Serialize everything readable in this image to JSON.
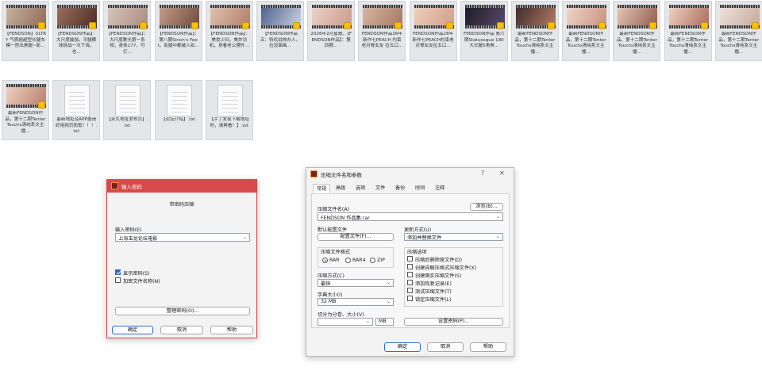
{
  "files": [
    {
      "type": "video",
      "name": "【FENDSON】ULTRY 气质超超型长腿车模一房出美腿~影...",
      "colors": [
        "#c9b3a3",
        "#8f6a55"
      ]
    },
    {
      "type": "video",
      "name": "【FENDSON作品】：大尺度瑜伽，平腿椰球挑战一次下海，也...",
      "colors": [
        "#9e7060",
        "#4b2c24"
      ]
    },
    {
      "type": "video",
      "name": "【FENDSON作品】：大尺度教光第一系视，身体177，可打...",
      "colors": [
        "#d8c6bd",
        "#a98a7f"
      ]
    },
    {
      "type": "video",
      "name": "【FENDSON作品】：第八期Sinon's Feet，有腿中都被人如...",
      "colors": [
        "#c59d8a",
        "#6e4a3c"
      ]
    },
    {
      "type": "video",
      "name": "【FENDSON作品】：美类少妇，美炸功机，身着老公摆外...",
      "colors": [
        "#e0c3b0",
        "#b07d68"
      ]
    },
    {
      "type": "video",
      "name": "【FENDSON作品五：特优战帅办人，拉设面画...",
      "colors": [
        "#4a5d8c",
        "#cfd5e0"
      ]
    },
    {
      "type": "video",
      "name": "2026年2月星歌，【FENDSON作品】：第四期...",
      "colors": [
        "#eed2c7",
        "#c79c8c"
      ]
    },
    {
      "type": "video",
      "name": "FENDSON作品26年新作七PEACH 约束老对脊女友 拉五口...",
      "colors": [
        "#d9b7a4",
        "#a57762"
      ]
    },
    {
      "type": "video",
      "name": "FENDSON作品28年新作七PEACH约束老对脊女友拉五口...",
      "colors": [
        "#f0d0bf",
        "#cf9e89"
      ]
    },
    {
      "type": "video",
      "name": "FENDSON作品 第六期Statuesque 180 大长腿5角美...",
      "colors": [
        "#1a1a26",
        "#5a4a6a"
      ]
    },
    {
      "type": "video",
      "name": "最新FENDSON作品，第十二期Tenter Touchs清纯系文主播...",
      "colors": [
        "#3b2a2a",
        "#b87c66"
      ]
    },
    {
      "type": "video",
      "name": "最新FENDSON作品，第十二期Tenter Touchs清纯系文主播...",
      "colors": [
        "#efd8cd",
        "#c98e7a"
      ]
    },
    {
      "type": "video",
      "name": "最新FENDSON作品，第十二期Tenter Touchs清纯系文主播...",
      "colors": [
        "#e7c9bb",
        "#8e5a4a"
      ]
    },
    {
      "type": "video",
      "name": "最新FENDSON作品，第十二期Tenter Touchs清纯系文主播...",
      "colors": [
        "#f2d4c6",
        "#a9685a"
      ]
    },
    {
      "type": "video",
      "name": "最新FENDSON作品，第十二期Tenter Touchs清纯系文主播...",
      "colors": [
        "#efe3dc",
        "#c6a899"
      ]
    },
    {
      "type": "video",
      "name": "最新FENDSON作品，第十二期Tenter Touchs清纯系文主播...",
      "colors": [
        "#f0d3c4",
        "#b97c69"
      ]
    },
    {
      "type": "txt",
      "name": "最新地址及APP邀请好用网页防取！！！.txt"
    },
    {
      "type": "txt",
      "name": "【永久地址发布页】.txt"
    },
    {
      "type": "txt",
      "name": "【论坛介绍】.txt"
    },
    {
      "type": "txt",
      "name": "【手了发现下载地址时，请再看！】.txt"
    }
  ],
  "password_dialog": {
    "title": "输入密码",
    "heading": "带密码压缩",
    "password_label": "输入密码(E)",
    "password_value": "上海玉龙论坛电影",
    "show_password": "显示密码(S)",
    "encrypt_names": "加密文件名称(N)",
    "manage_passwords": "整理密码(O)...",
    "ok": "确定",
    "cancel": "取消",
    "help": "帮助"
  },
  "archive_dialog": {
    "title": "压缩文件名和参数",
    "help_glyph": "?",
    "close_glyph": "✕",
    "tabs": [
      "常规",
      "高级",
      "选项",
      "文件",
      "备份",
      "时间",
      "注释"
    ],
    "archive_name_label": "压缩文件名(A)",
    "browse": "浏览(B)...",
    "archive_name_value": "FENDSON 作品集.rar",
    "default_profile_label": "默认配置文件",
    "profile_button": "配置文件(F)...",
    "update_mode_label": "更新方式(U)",
    "update_mode_value": "添加并替换文件",
    "format_label": "压缩文件格式",
    "formats": [
      "RAR",
      "RAR4",
      "ZIP"
    ],
    "selected_format": "RAR",
    "method_label": "压缩方式(C)",
    "method_value": "最快",
    "dict_label": "字典大小(I)",
    "dict_value": "32 MB",
    "split_label": "切分为分卷、大小(V)",
    "split_unit": "MB",
    "options_label": "压缩选项",
    "options": [
      {
        "label": "压缩后删除原文件(D)",
        "checked": false
      },
      {
        "label": "创建自解压格式压缩文件(X)",
        "checked": false
      },
      {
        "label": "创建固实压缩文件(S)",
        "checked": false
      },
      {
        "label": "添加恢复记录(E)",
        "checked": false
      },
      {
        "label": "测试压缩文件(T)",
        "checked": false
      },
      {
        "label": "锁定压缩文件(L)",
        "checked": false
      }
    ],
    "set_password": "设置密码(P)...",
    "ok": "确定",
    "cancel": "取消",
    "help": "帮助"
  },
  "colors": {
    "accent": "#2a66c8",
    "dialog_border_red": "#d84a4a",
    "badge": "#f4c20d"
  }
}
